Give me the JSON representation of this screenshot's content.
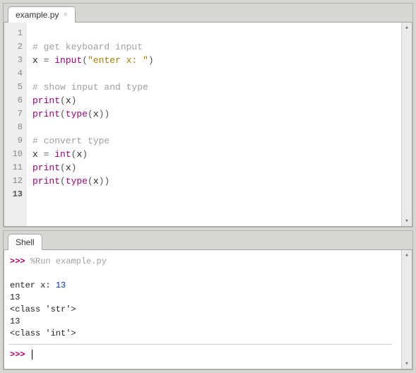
{
  "editor": {
    "tab_label": "example.py",
    "lines": [
      {
        "n": 1,
        "tokens": []
      },
      {
        "n": 2,
        "tokens": [
          {
            "t": "# get keyboard input",
            "c": "tok-comment"
          }
        ]
      },
      {
        "n": 3,
        "tokens": [
          {
            "t": "x ",
            "c": "tok-ident"
          },
          {
            "t": "=",
            "c": "tok-op"
          },
          {
            "t": " ",
            "c": "tok-ident"
          },
          {
            "t": "input",
            "c": "tok-builtin"
          },
          {
            "t": "(",
            "c": "tok-paren"
          },
          {
            "t": "\"enter x: \"",
            "c": "tok-string"
          },
          {
            "t": ")",
            "c": "tok-paren"
          }
        ]
      },
      {
        "n": 4,
        "tokens": []
      },
      {
        "n": 5,
        "tokens": [
          {
            "t": "# show input and type",
            "c": "tok-comment"
          }
        ]
      },
      {
        "n": 6,
        "tokens": [
          {
            "t": "print",
            "c": "tok-builtin"
          },
          {
            "t": "(",
            "c": "tok-paren"
          },
          {
            "t": "x",
            "c": "tok-ident"
          },
          {
            "t": ")",
            "c": "tok-paren"
          }
        ]
      },
      {
        "n": 7,
        "tokens": [
          {
            "t": "print",
            "c": "tok-builtin"
          },
          {
            "t": "(",
            "c": "tok-paren"
          },
          {
            "t": "type",
            "c": "tok-builtin"
          },
          {
            "t": "(",
            "c": "tok-paren"
          },
          {
            "t": "x",
            "c": "tok-ident"
          },
          {
            "t": ")",
            "c": "tok-paren"
          },
          {
            "t": ")",
            "c": "tok-paren"
          }
        ]
      },
      {
        "n": 8,
        "tokens": []
      },
      {
        "n": 9,
        "tokens": [
          {
            "t": "# convert type",
            "c": "tok-comment"
          }
        ]
      },
      {
        "n": 10,
        "tokens": [
          {
            "t": "x ",
            "c": "tok-ident"
          },
          {
            "t": "=",
            "c": "tok-op"
          },
          {
            "t": " ",
            "c": "tok-ident"
          },
          {
            "t": "int",
            "c": "tok-builtin"
          },
          {
            "t": "(",
            "c": "tok-paren"
          },
          {
            "t": "x",
            "c": "tok-ident"
          },
          {
            "t": ")",
            "c": "tok-paren"
          }
        ]
      },
      {
        "n": 11,
        "tokens": [
          {
            "t": "print",
            "c": "tok-builtin"
          },
          {
            "t": "(",
            "c": "tok-paren"
          },
          {
            "t": "x",
            "c": "tok-ident"
          },
          {
            "t": ")",
            "c": "tok-paren"
          }
        ]
      },
      {
        "n": 12,
        "tokens": [
          {
            "t": "print",
            "c": "tok-builtin"
          },
          {
            "t": "(",
            "c": "tok-paren"
          },
          {
            "t": "type",
            "c": "tok-builtin"
          },
          {
            "t": "(",
            "c": "tok-paren"
          },
          {
            "t": "x",
            "c": "tok-ident"
          },
          {
            "t": ")",
            "c": "tok-paren"
          },
          {
            "t": ")",
            "c": "tok-paren"
          }
        ]
      },
      {
        "n": 13,
        "tokens": []
      }
    ],
    "current_line": 13
  },
  "shell": {
    "tab_label": "Shell",
    "prompt": ">>>",
    "run_cmd": "%Run example.py",
    "output": [
      {
        "kind": "inout",
        "prefix": "  enter x: ",
        "value": "13"
      },
      {
        "kind": "plain",
        "text": "  13"
      },
      {
        "kind": "plain",
        "text": "  <class 'str'>"
      },
      {
        "kind": "plain",
        "text": "  13"
      },
      {
        "kind": "plain",
        "text": "  <class 'int'>"
      }
    ]
  }
}
